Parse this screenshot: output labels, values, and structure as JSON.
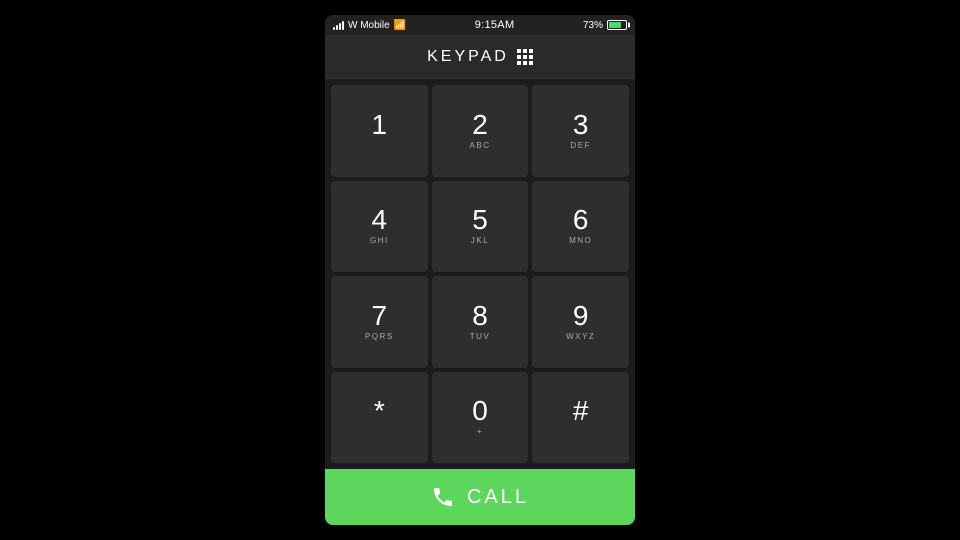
{
  "status_bar": {
    "carrier": "W Mobile",
    "time": "9:15AM",
    "battery_percent": "73%"
  },
  "header": {
    "title": "KEYPAD"
  },
  "keypad": {
    "rows": [
      [
        {
          "number": "1",
          "letters": ""
        },
        {
          "number": "2",
          "letters": "ABC"
        },
        {
          "number": "3",
          "letters": "DEF"
        }
      ],
      [
        {
          "number": "4",
          "letters": "GHI"
        },
        {
          "number": "5",
          "letters": "JKL"
        },
        {
          "number": "6",
          "letters": "MNO"
        }
      ],
      [
        {
          "number": "7",
          "letters": "PQRS"
        },
        {
          "number": "8",
          "letters": "TUV"
        },
        {
          "number": "9",
          "letters": "WXYZ"
        }
      ],
      [
        {
          "number": "*",
          "letters": ""
        },
        {
          "number": "0",
          "letters": "+"
        },
        {
          "number": "#",
          "letters": ""
        }
      ]
    ]
  },
  "call_button": {
    "label": "CALL"
  },
  "colors": {
    "call_green": "#5cd65c",
    "key_bg": "#2e2e2e",
    "header_bg": "#2a2a2a"
  }
}
